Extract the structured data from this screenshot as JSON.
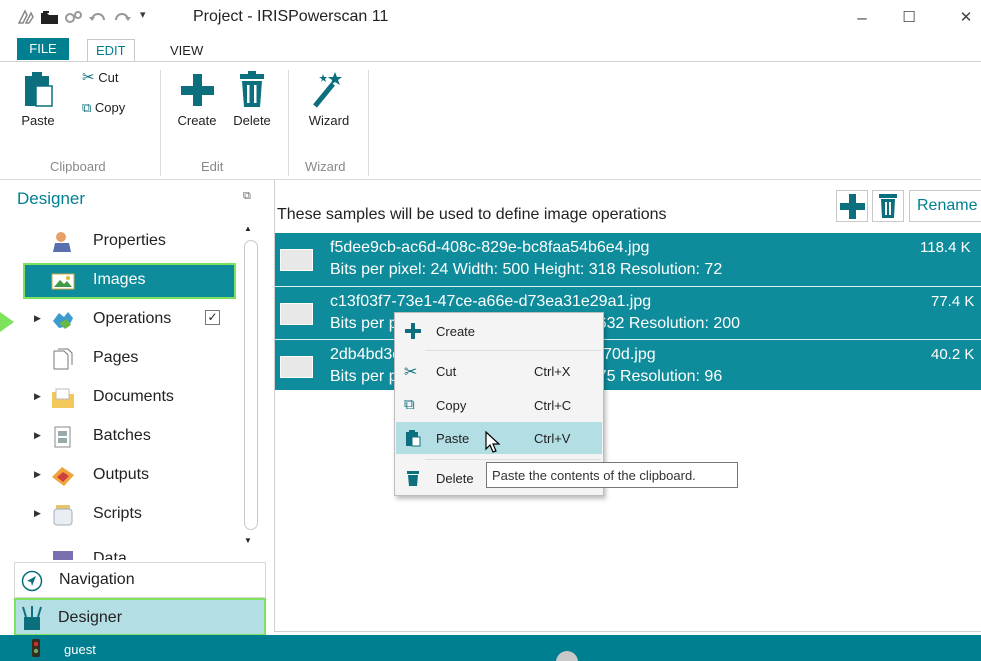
{
  "window": {
    "title": "Project - IRISPowerscan 11",
    "minimize": "–",
    "maximize": "☐",
    "close": "✕"
  },
  "ribbon": {
    "tabs": [
      "FILE",
      "EDIT",
      "VIEW"
    ],
    "active_tab": "EDIT",
    "groups": [
      {
        "label": "Clipboard",
        "buttons": [
          "Paste",
          "Cut",
          "Copy"
        ]
      },
      {
        "label": "Edit",
        "buttons": [
          "Create",
          "Delete"
        ]
      },
      {
        "label": "Wizard",
        "buttons": [
          "Wizard"
        ]
      }
    ]
  },
  "designer": {
    "header": "Designer",
    "items": [
      {
        "label": "Properties",
        "icon": "properties-icon",
        "expandable": false
      },
      {
        "label": "Images",
        "icon": "images-icon",
        "expandable": false,
        "selected": true
      },
      {
        "label": "Operations",
        "icon": "operations-icon",
        "expandable": true,
        "checked": true
      },
      {
        "label": "Pages",
        "icon": "pages-icon",
        "expandable": false
      },
      {
        "label": "Documents",
        "icon": "documents-icon",
        "expandable": true
      },
      {
        "label": "Batches",
        "icon": "batches-icon",
        "expandable": true
      },
      {
        "label": "Outputs",
        "icon": "outputs-icon",
        "expandable": true
      },
      {
        "label": "Scripts",
        "icon": "scripts-icon",
        "expandable": true
      },
      {
        "label": "Data",
        "icon": "data-icon",
        "expandable": true
      }
    ],
    "nav_buttons": [
      "Navigation",
      "Designer"
    ]
  },
  "samples": {
    "caption": "These samples will be used to define image operations",
    "rename_label": "Rename",
    "rows": [
      {
        "filename": "f5dee9cb-ac6d-408c-829e-bc8faa54b6e4.jpg",
        "info": "Bits per pixel: 24 Width: 500 Height: 318 Resolution: 72",
        "size": "118.4 K"
      },
      {
        "filename": "c13f03f7-73e1-47ce-a66e-d73ea31e29a1.jpg",
        "info": "Bits per pixel: 24 Width: 1000 Height: 632 Resolution: 200",
        "size": "77.4 K"
      },
      {
        "filename": "2db4bd3e-4b1f-4a08-9c3e-77a5dca1270d.jpg",
        "info": "Bits per pixel: 24 Width: 435 Height: 275 Resolution: 96",
        "size": "40.2 K"
      }
    ]
  },
  "context_menu": {
    "items": [
      {
        "label": "Create",
        "shortcut": "",
        "icon": "plus-icon"
      },
      {
        "label": "Cut",
        "shortcut": "Ctrl+X",
        "icon": "scissors-icon"
      },
      {
        "label": "Copy",
        "shortcut": "Ctrl+C",
        "icon": "copy-icon"
      },
      {
        "label": "Paste",
        "shortcut": "Ctrl+V",
        "icon": "clipboard-icon",
        "hovered": true
      },
      {
        "label": "Delete",
        "shortcut": "",
        "icon": "trash-icon"
      }
    ]
  },
  "tooltip": "Paste the contents of the clipboard.",
  "status": {
    "user": "guest"
  },
  "colors": {
    "accent": "#007f90",
    "selection": "#0f8c9b",
    "hover": "#b3dfe4",
    "highlight_outline": "#7ee35b"
  }
}
